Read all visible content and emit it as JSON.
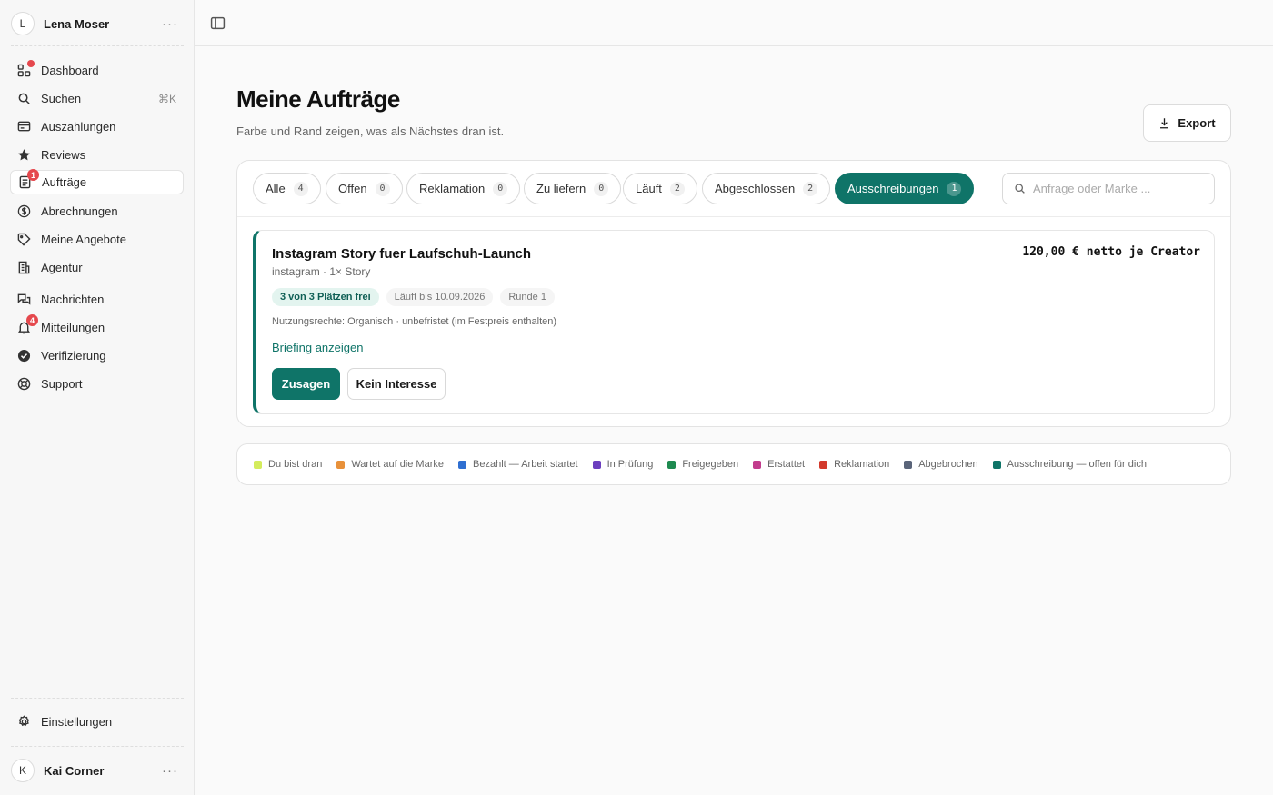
{
  "sidebar": {
    "user": {
      "initial": "L",
      "name": "Lena Moser"
    },
    "nav": [
      {
        "label": "Dashboard",
        "icon": "grid-plus-icon",
        "badge": "dot"
      },
      {
        "label": "Suchen",
        "icon": "search-icon",
        "shortcut": "⌘K"
      },
      {
        "label": "Auszahlungen",
        "icon": "receipt-icon"
      },
      {
        "label": "Reviews",
        "icon": "star-icon"
      },
      {
        "label": "Aufträge",
        "icon": "orders-icon",
        "badge": "1",
        "active": true
      },
      {
        "label": "Abrechnungen",
        "icon": "dollar-circle-icon"
      },
      {
        "label": "Meine Angebote",
        "icon": "tag-icon"
      },
      {
        "label": "Agentur",
        "icon": "building-icon"
      },
      {
        "label": "Nachrichten",
        "icon": "chat-icon"
      },
      {
        "label": "Mitteilungen",
        "icon": "bell-icon",
        "badge": "4"
      },
      {
        "label": "Verifizierung",
        "icon": "check-circle-icon"
      },
      {
        "label": "Support",
        "icon": "lifebuoy-icon"
      }
    ],
    "settings_label": "Einstellungen",
    "footer": {
      "initial": "K",
      "name": "Kai Corner"
    }
  },
  "main": {
    "title": "Meine Aufträge",
    "subtitle": "Farbe und Rand zeigen, was als Nächstes dran ist.",
    "export_label": "Export",
    "filters": [
      {
        "label": "Alle",
        "count": "4"
      },
      {
        "label": "Offen",
        "count": "0"
      },
      {
        "label": "Reklamation",
        "count": "0"
      },
      {
        "label": "Zu liefern",
        "count": "0"
      },
      {
        "label": "Läuft",
        "count": "2"
      },
      {
        "label": "Abgeschlossen",
        "count": "2"
      },
      {
        "label": "Ausschreibungen",
        "count": "1",
        "active": true
      }
    ],
    "search_placeholder": "Anfrage oder Marke ...",
    "card": {
      "title": "Instagram Story fuer Laufschuh-Launch",
      "subtitle": "instagram · 1× Story",
      "price": "120,00 € netto je Creator",
      "tags": [
        "3 von 3 Plätzen frei",
        "Läuft bis 10.09.2026",
        "Runde 1"
      ],
      "rights": "Nutzungsrechte: Organisch · unbefristet (im Festpreis enthalten)",
      "briefing_link": "Briefing anzeigen",
      "accept_label": "Zusagen",
      "decline_label": "Kein Interesse"
    },
    "legend": [
      {
        "label": "Du bist dran",
        "color": "#d4ec5c"
      },
      {
        "label": "Wartet auf die Marke",
        "color": "#e8913a"
      },
      {
        "label": "Bezahlt — Arbeit startet",
        "color": "#2f6fd1"
      },
      {
        "label": "In Prüfung",
        "color": "#6c3fbf"
      },
      {
        "label": "Freigegeben",
        "color": "#1e8a50"
      },
      {
        "label": "Erstattet",
        "color": "#c23c8d"
      },
      {
        "label": "Reklamation",
        "color": "#d33a2c"
      },
      {
        "label": "Abgebrochen",
        "color": "#5a6479"
      },
      {
        "label": "Ausschreibung — offen für dich",
        "color": "#0f7468"
      }
    ]
  },
  "colors": {
    "accent": "#0f7468",
    "badge": "#e5484d"
  }
}
